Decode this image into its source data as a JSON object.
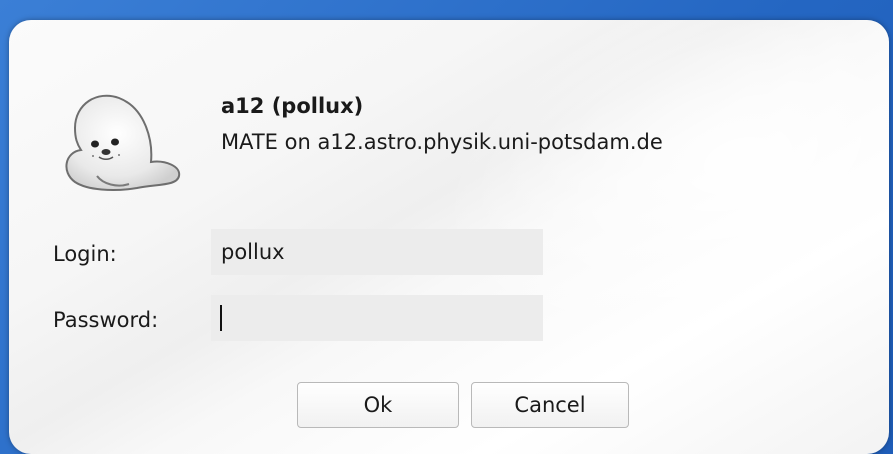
{
  "dialog": {
    "host_title": "a12 (pollux)",
    "host_subtitle": "MATE on a12.astro.physik.uni-potsdam.de",
    "avatar_icon": "seal-avatar-icon"
  },
  "form": {
    "login_label": "Login:",
    "login_value": "pollux",
    "password_label": "Password:",
    "password_value": ""
  },
  "buttons": {
    "ok_label": "Ok",
    "cancel_label": "Cancel"
  },
  "colors": {
    "desktop_background": "#2e73c9",
    "dialog_background": "#f6f6f6",
    "field_background": "#ececec"
  }
}
